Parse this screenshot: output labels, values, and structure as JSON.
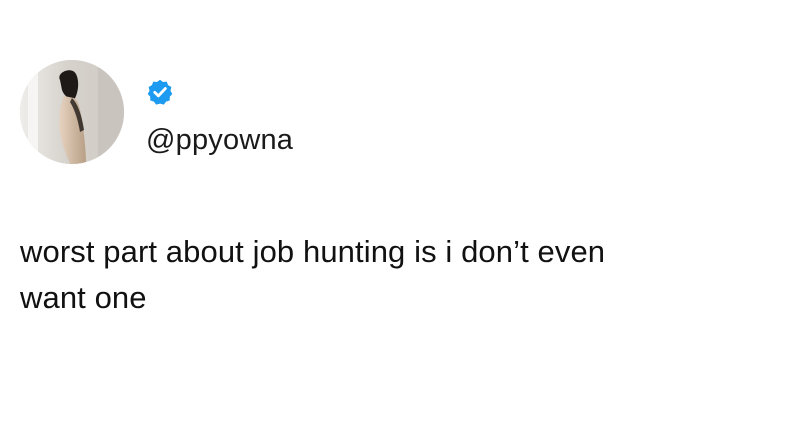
{
  "tweet": {
    "handle": "@ppyowna",
    "verified": true,
    "text_line_1": "worst part about job hunting is i don’t even",
    "text_line_2": "want one"
  },
  "icons": {
    "verified": "verified-badge-icon",
    "avatar": "profile-photo"
  },
  "colors": {
    "verified_badge": "#1d9bf0",
    "text": "#111111",
    "background": "#ffffff"
  }
}
